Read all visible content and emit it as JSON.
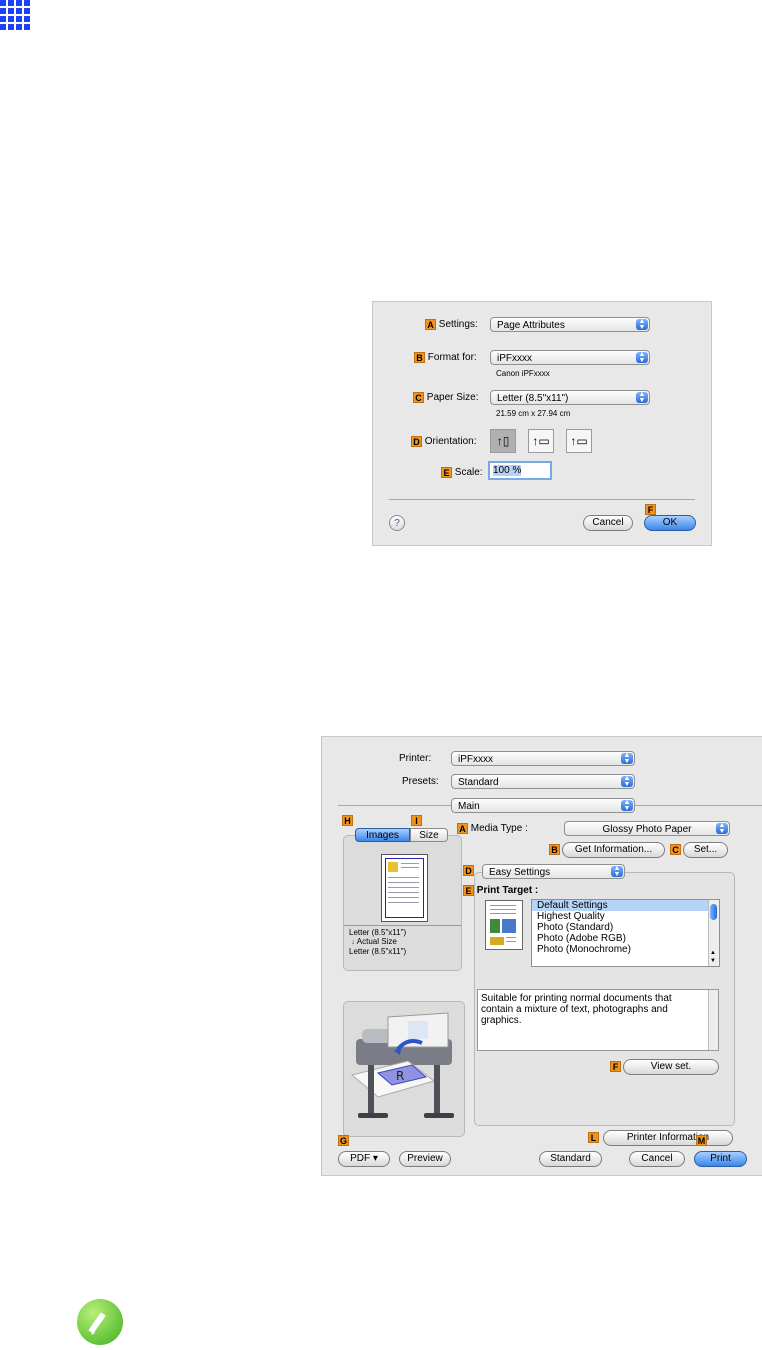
{
  "page_setup": {
    "settings_label": "Settings:",
    "settings_value": "Page Attributes",
    "format_label": "Format for:",
    "format_value": "iPFxxxx",
    "format_sub": "Canon iPFxxxx",
    "paper_label": "Paper Size:",
    "paper_value": "Letter (8.5\"x11\")",
    "paper_sub": "21.59 cm x 27.94 cm",
    "orientation_label": "Orientation:",
    "scale_label": "Scale:",
    "scale_value": "100 %",
    "cancel": "Cancel",
    "ok": "OK",
    "help": "?",
    "letters": {
      "a": "A",
      "b": "B",
      "c": "C",
      "d": "D",
      "e": "E",
      "f": "F"
    }
  },
  "print_dialog": {
    "printer_label": "Printer:",
    "printer_value": "iPFxxxx",
    "presets_label": "Presets:",
    "presets_value": "Standard",
    "panel_value": "Main",
    "tab_images": "Images",
    "tab_size": "Size",
    "media_type_label": "Media Type :",
    "media_type_value": "Glossy Photo Paper",
    "get_information": "Get Information...",
    "set": "Set...",
    "easy_settings": "Easy Settings",
    "print_target_label": "Print Target :",
    "targets": [
      "Default Settings",
      "Highest Quality",
      "Photo (Standard)",
      "Photo (Adobe RGB)",
      "Photo (Monochrome)"
    ],
    "description": "Suitable for printing normal documents that contain a mixture of text, photographs and graphics.",
    "view_set": "View set.",
    "printer_information": "Printer Information",
    "paper_line1": "Letter (8.5\"x11\")",
    "paper_line2": "Actual Size",
    "paper_line3": "Letter (8.5\"x11\")",
    "pdf": "PDF ▾",
    "preview": "Preview",
    "standard": "Standard",
    "cancel": "Cancel",
    "print": "Print",
    "letters": {
      "a": "A",
      "b": "B",
      "c": "C",
      "d": "D",
      "e": "E",
      "f": "F",
      "g": "G",
      "h": "H",
      "i": "I",
      "l": "L",
      "m": "M"
    }
  },
  "icons": {
    "top": "grid-icon",
    "note": "pencil-note-icon"
  },
  "colors": {
    "accent_blue": "#1f3fff",
    "letter_orange": "#f0941e",
    "note_green": "#5ec82a"
  }
}
